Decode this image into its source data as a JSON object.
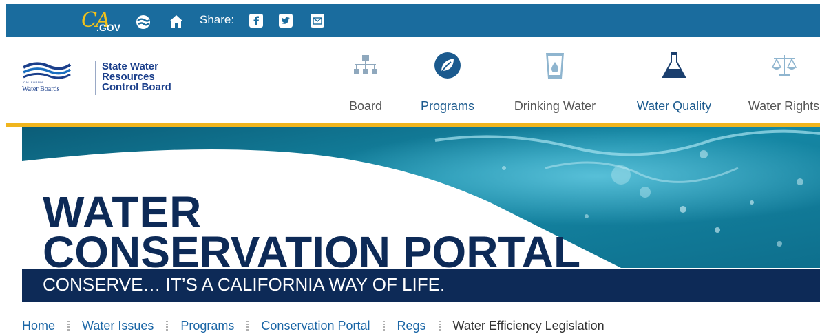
{
  "topbar": {
    "logo_ca": "CA",
    "logo_gov": ".GOV",
    "share_label": "Share:",
    "icons": [
      "globe-icon",
      "home-icon",
      "facebook-icon",
      "twitter-icon",
      "mail-icon"
    ],
    "color": "#1a6c9e"
  },
  "header": {
    "logo_text": "Water Boards",
    "logo_small": "CALIFORNIA",
    "title_lines": [
      "State Water",
      "Resources",
      "Control Board"
    ],
    "nav": [
      {
        "label": "Board",
        "icon": "org-chart-icon"
      },
      {
        "label": "Programs",
        "icon": "leaf-icon"
      },
      {
        "label": "Drinking Water",
        "icon": "water-glass-icon"
      },
      {
        "label": "Water Quality",
        "icon": "flask-icon"
      },
      {
        "label": "Water Rights",
        "icon": "scales-icon"
      }
    ],
    "accent": "#f0b51e"
  },
  "banner": {
    "title_line1": "WATER",
    "title_line2": "CONSERVATION PORTAL",
    "tagline": "CONSERVE… IT’S A CALIFORNIA WAY OF LIFE.",
    "navy": "#0d2a57"
  },
  "breadcrumb": {
    "items": [
      "Home",
      "Water Issues",
      "Programs",
      "Conservation Portal",
      "Regs"
    ],
    "current": "Water Efficiency Legislation"
  }
}
